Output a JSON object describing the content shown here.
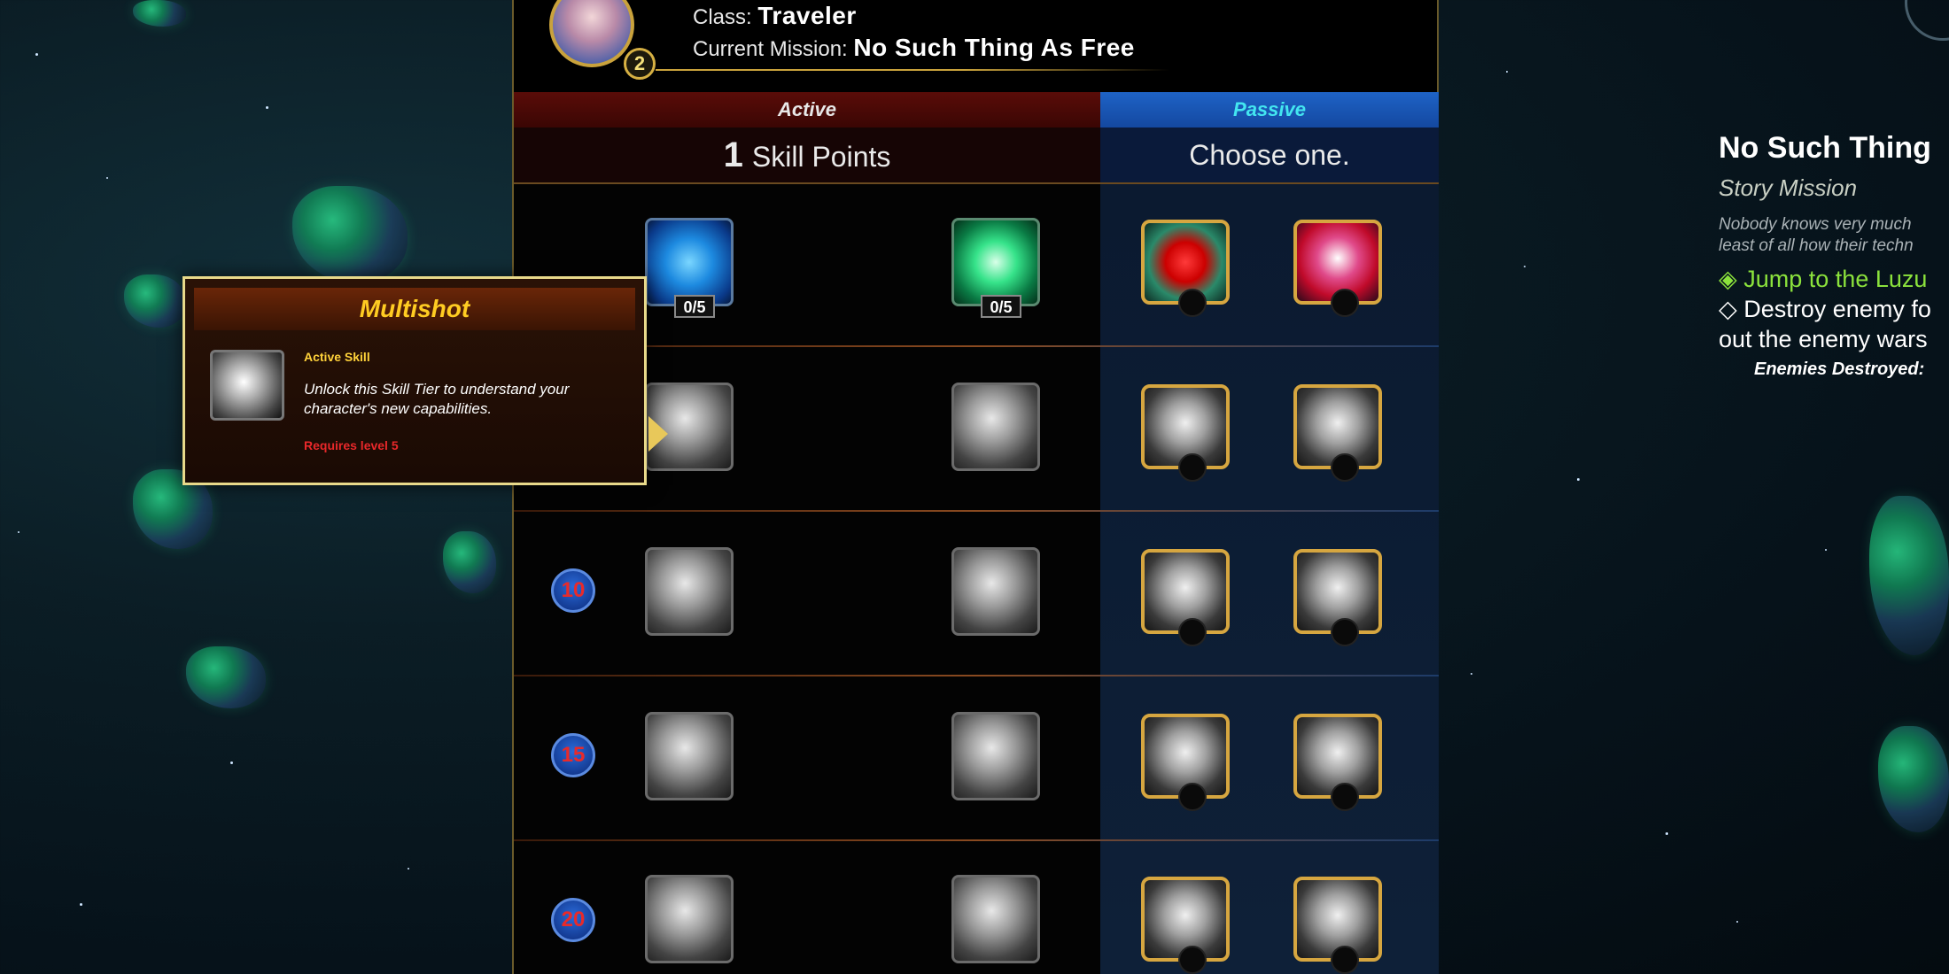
{
  "header": {
    "class_label": "Class:",
    "class_value": "Traveler",
    "mission_label": "Current Mission:",
    "mission_value": "No Such Thing As Free",
    "player_level": "2"
  },
  "tabs": {
    "active_label": "Active",
    "passive_label": "Passive"
  },
  "points": {
    "active_count": "1",
    "active_text": "Skill Points",
    "passive_text": "Choose one."
  },
  "skills": {
    "row1_left_rank": "0/5",
    "row1_right_rank": "0/5"
  },
  "tiers": [
    "10",
    "15",
    "20"
  ],
  "tooltip": {
    "title": "Multishot",
    "type": "Active Skill",
    "description": "Unlock this Skill Tier to understand your character's new capabilities.",
    "requirement": "Requires level 5"
  },
  "mission": {
    "title": "No Such Thing",
    "type": "Story Mission",
    "desc_line1": "Nobody knows very much",
    "desc_line2": "least of all how their techn",
    "objective1": "Jump to the Luzu",
    "objective2_line1": "Destroy enemy fo",
    "objective2_line2": "out the enemy wars",
    "enemies_label": "Enemies Destroyed:"
  },
  "colors": {
    "active_tab": "#5a0c08",
    "passive_tab": "#1e63c6",
    "passive_text": "#43e6f0",
    "gold_accent": "#d6a640",
    "objective_green": "#8be23c",
    "requirement_red": "#e8282a"
  }
}
